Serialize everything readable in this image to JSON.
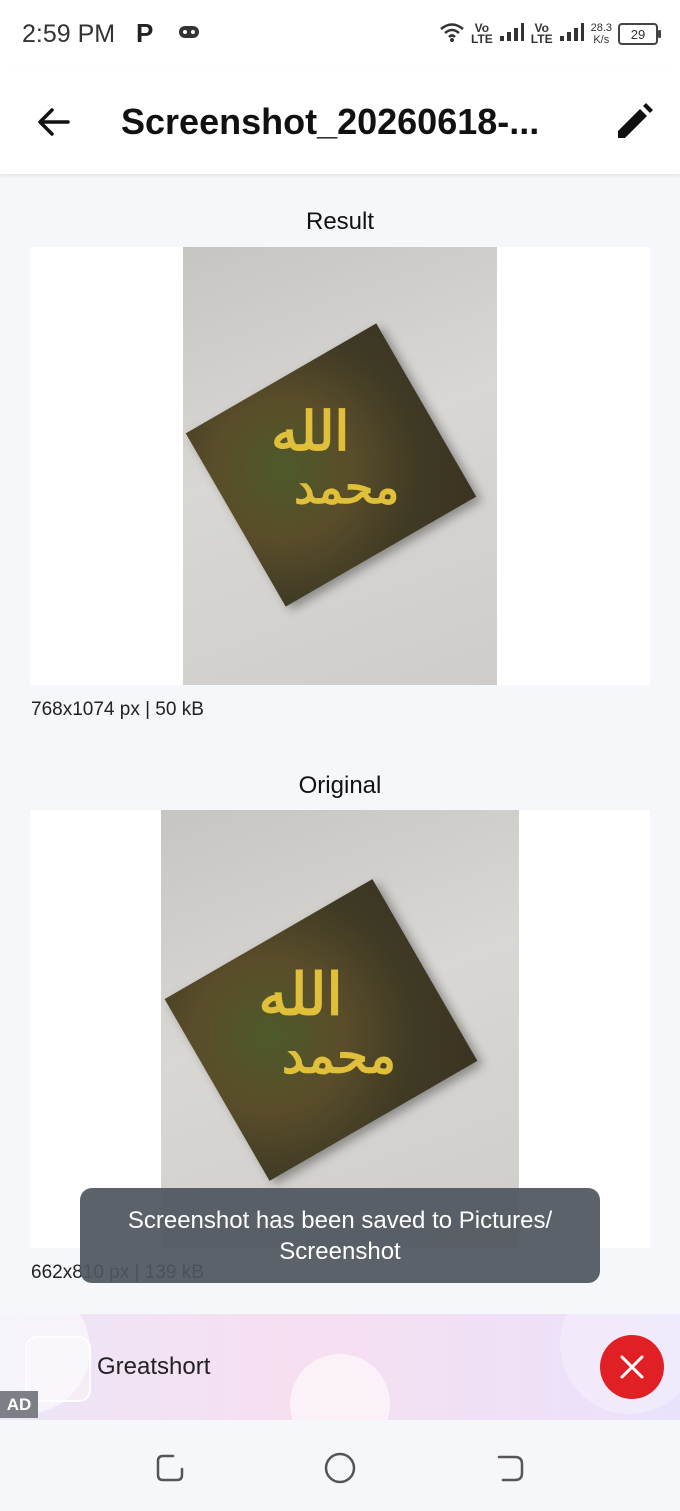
{
  "status_bar": {
    "time": "2:59 PM",
    "indicator_p": "P",
    "net1_top": "Vo",
    "net1_bottom": "LTE",
    "net2_top": "Vo",
    "net2_bottom": "LTE",
    "speed_value": "28.3",
    "speed_unit": "K/s",
    "battery": "29"
  },
  "app_bar": {
    "title": "Screenshot_20260618-..."
  },
  "result": {
    "label": "Result",
    "meta": "768x1074 px | 50 kB"
  },
  "original": {
    "label": "Original",
    "meta": "662x810 px | 139 kB"
  },
  "toast": {
    "message": "Screenshot has been saved to  Pictures/ Screenshot"
  },
  "ad": {
    "name": "Greatshort",
    "tag": "AD"
  },
  "icons": {
    "back": "back-arrow-icon",
    "edit": "pencil-icon",
    "ad_action": "close-icon"
  },
  "colors": {
    "ad_button": "#e02025",
    "toast_bg": "#50565e"
  }
}
